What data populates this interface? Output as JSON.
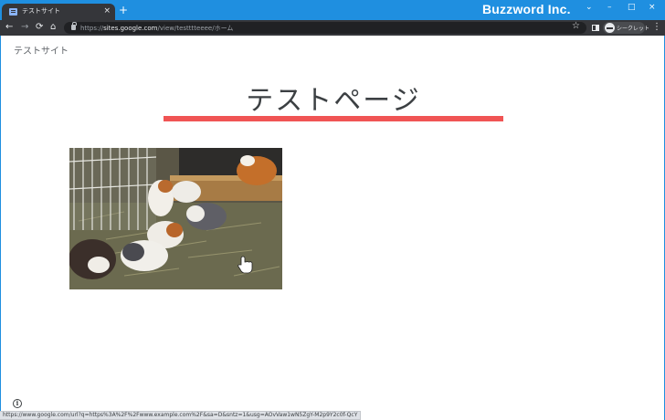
{
  "browser": {
    "tab": {
      "title": "テストサイト",
      "close_icon": "×"
    },
    "new_tab_icon": "+",
    "brand": "Buzzword Inc.",
    "window_controls": {
      "dropdown": "⌄",
      "minimize": "–",
      "maximize": "□",
      "close": "×"
    },
    "toolbar": {
      "back_icon": "←",
      "forward_icon": "→",
      "reload_icon": "⟳",
      "home_icon": "⌂",
      "url_prefix": "https://",
      "url_host": "sites.google.com",
      "url_path": "/view/testttteeee/ホーム",
      "star_icon": "☆",
      "incognito_label": "シークレット",
      "menu_icon": "⋮"
    }
  },
  "page": {
    "site_name": "テストサイト",
    "heading": "テストページ",
    "accent_color": "#f05454",
    "image_subject": "guinea pigs in hay enclosure",
    "info_icon": "i"
  },
  "status_bar": {
    "link_url": "https://www.google.com/url?q=https%3A%2F%2Fwww.example.com%2F&sa=D&sntz=1&usg=AOvVaw1wN5ZgY-M2p9Y2c0f-QcY"
  }
}
